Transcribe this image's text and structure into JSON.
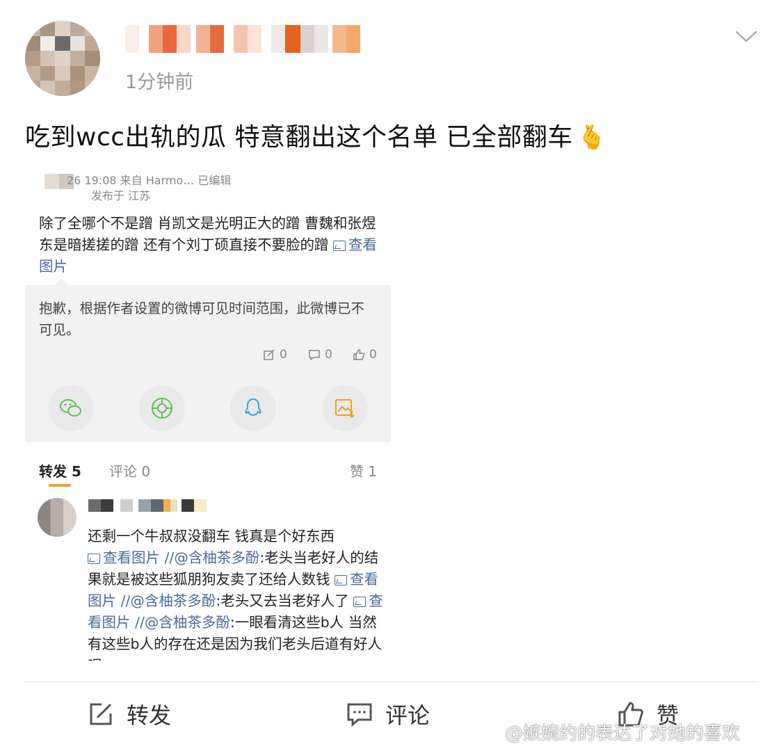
{
  "post": {
    "time": "1分钟前",
    "text": "吃到wcc出轨的瓜 特意翻出这个名单 已全部翻车",
    "emoji": "🫰"
  },
  "screenshot": {
    "meta_line1": "26 19:08 来自 Harmo… 已编辑",
    "meta_line2": "发布于 江苏",
    "body": "除了全哪个不是蹭 肖凯文是光明正大的蹭 曹魏和张煜东是暗搓搓的蹭 还有个刘丁硕直接不要脸的蹭",
    "view_image": "查看图片",
    "notice": "抱歉，根据作者设置的微博可见时间范围，此微博已不可见。",
    "stats": {
      "repost": "0",
      "comment": "0",
      "like": "0"
    },
    "share_icons": [
      "wechat-icon",
      "moments-icon",
      "qq-icon",
      "save-image-icon"
    ],
    "tabs": {
      "repost": "转发 5",
      "comment": "评论 0",
      "like": "赞 1"
    },
    "comment": {
      "text_1": "还剩一个牛叔叔没翻车 钱真是个好东西",
      "view_image": "查看图片",
      "mention": "//@含柚茶多酚",
      "text_2": ":老头当老好人的结果就是被这些狐朋狗友卖了还给人数钱",
      "text_3": ":老头又去当老好人了",
      "text_4": ":一眼看清这些b人 当然有这些b人的存在还是因为我们老头后道有好人呢"
    }
  },
  "actions": {
    "repost": "转发",
    "comment": "评论",
    "like": "赞"
  },
  "watermark": "@嫉婉约的表达了对她的喜欢",
  "colors": {
    "link": "#4a6b9a",
    "tab_accent": "#f0a030",
    "muted": "#9a9a9a"
  }
}
